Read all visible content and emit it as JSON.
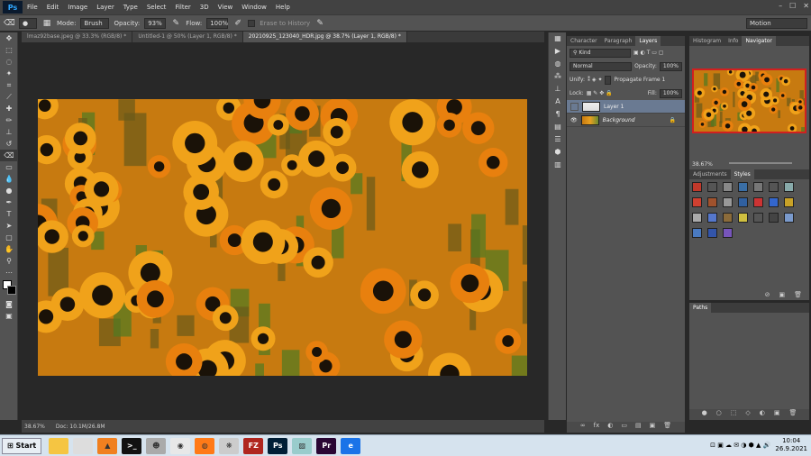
{
  "menubar": {
    "logo": "Ps",
    "items": [
      "File",
      "Edit",
      "Image",
      "Layer",
      "Type",
      "Select",
      "Filter",
      "3D",
      "View",
      "Window",
      "Help"
    ],
    "window_controls": [
      "–",
      "☐",
      "✕"
    ]
  },
  "options": {
    "mode_label": "Mode:",
    "mode_value": "Brush",
    "opacity_label": "Opacity:",
    "opacity_value": "93%",
    "flow_label": "Flow:",
    "flow_value": "100%",
    "erase_history": "Erase to History",
    "workspace": "Motion"
  },
  "tabs": [
    {
      "label": "lmaz92base.jpeg @ 33.3% (RGB/8) *"
    },
    {
      "label": "Untitled-1 @ 50% (Layer 1, RGB/8) *"
    },
    {
      "label": "20210925_123040_HDR.jpg @ 38.7% (Layer 1, RGB/8) *"
    }
  ],
  "status": {
    "zoom": "38.67%",
    "doc": "Doc: 10.1M/26.8M"
  },
  "layers_panel": {
    "tabs": [
      "Character",
      "Paragraph",
      "Layers"
    ],
    "kind": "Kind",
    "blend": "Normal",
    "opacity_label": "Opacity:",
    "opacity_value": "100%",
    "unify_label": "Unify:",
    "propagate": "Propagate Frame 1",
    "lock_label": "Lock:",
    "fill_label": "Fill:",
    "fill_value": "100%",
    "layers": [
      {
        "name": "Layer 1"
      },
      {
        "name": "Background"
      }
    ],
    "bottom_icons": [
      "∞",
      "fx",
      "◐",
      "▭",
      "▤",
      "▣",
      "🗑"
    ]
  },
  "navigator": {
    "tabs": [
      "Histogram",
      "Info",
      "Navigator"
    ],
    "zoom": "38.67%"
  },
  "styles_panel": {
    "tabs": [
      "Adjustments",
      "Styles"
    ],
    "swatches": [
      "#c0392b",
      "#555",
      "#888",
      "#3a6ea5",
      "#777",
      "#555",
      "#8aa",
      "#d04030",
      "#a0522d",
      "#999",
      "#3060a0",
      "#cc3333",
      "#3366cc",
      "#c9a227",
      "#aaa",
      "#5577cc",
      "#8b6b3a",
      "#d0c040",
      "#555",
      "#444",
      "#7a9acc",
      "#4a7ac0",
      "#3355aa",
      "#7755bb"
    ]
  },
  "paths_panel": {
    "tab": "Paths"
  },
  "taskbar": {
    "start": "Start",
    "apps": [
      {
        "label": "",
        "color": "#f5c542",
        "name": "file-explorer-icon"
      },
      {
        "label": "",
        "color": "#ddd",
        "name": "library-icon"
      },
      {
        "label": "▲",
        "color": "#f08020",
        "name": "vlc-icon"
      },
      {
        "label": ">_",
        "color": "#111",
        "name": "terminal-icon"
      },
      {
        "label": "☻",
        "color": "#aaa",
        "name": "alien-icon"
      },
      {
        "label": "◉",
        "color": "#e8e8e8",
        "name": "chrome-icon"
      },
      {
        "label": "◍",
        "color": "#ff7a18",
        "name": "firefox-icon"
      },
      {
        "label": "❋",
        "color": "#ccc",
        "name": "settings-app-icon"
      },
      {
        "label": "FZ",
        "color": "#b0261f",
        "name": "filezilla-icon"
      },
      {
        "label": "Ps",
        "color": "#001e36",
        "name": "photoshop-icon"
      },
      {
        "label": "▨",
        "color": "#9cc",
        "name": "image-app-icon"
      },
      {
        "label": "Pr",
        "color": "#2a0634",
        "name": "premiere-icon"
      },
      {
        "label": "e",
        "color": "#1a73e8",
        "name": "edge-icon"
      }
    ],
    "time": "10:04",
    "date": "26.9.2021"
  }
}
